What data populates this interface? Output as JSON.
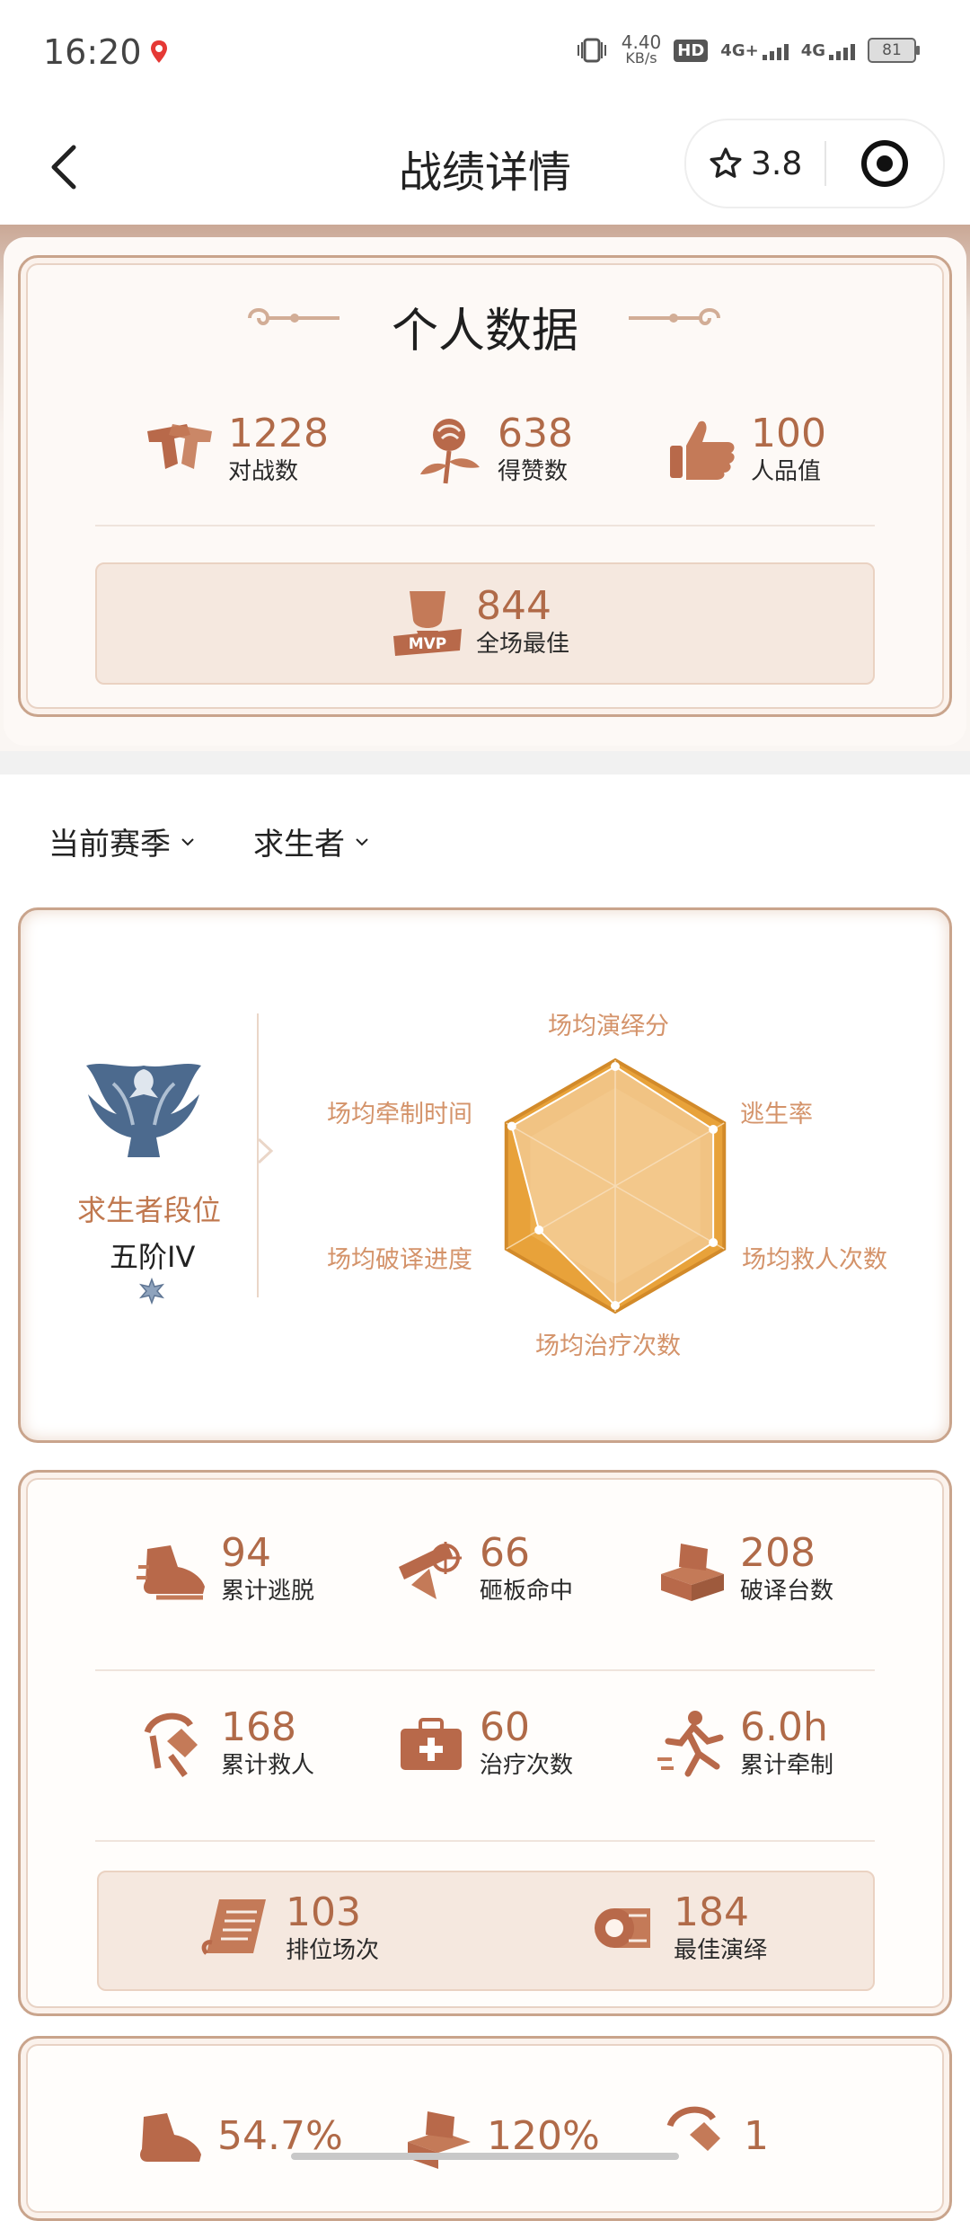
{
  "status_bar": {
    "time": "16:20",
    "speed_value": "4.40",
    "speed_unit": "KB/s",
    "hd_badge": "HD",
    "sim1": "1",
    "sim2": "2",
    "net1": "4G+",
    "net2": "4G",
    "battery": "81"
  },
  "header": {
    "title": "战绩详情",
    "rating": "3.8"
  },
  "personal": {
    "title": "个人数据",
    "stats": [
      {
        "value": "1228",
        "label": "对战数",
        "icon": "pistol-icon"
      },
      {
        "value": "638",
        "label": "得赞数",
        "icon": "rose-icon"
      },
      {
        "value": "100",
        "label": "人品值",
        "icon": "thumbs-up-icon"
      }
    ],
    "mvp": {
      "value": "844",
      "label": "全场最佳",
      "badge": "MVP",
      "icon": "mvp-trophy-icon"
    }
  },
  "filters": {
    "season": "当前赛季",
    "role": "求生者"
  },
  "rank": {
    "label": "求生者段位",
    "value": "五阶IV",
    "radar": {
      "axes": [
        "场均演绎分",
        "逃生率",
        "场均救人次数",
        "场均治疗次数",
        "场均破译进度",
        "场均牵制时间"
      ],
      "values": [
        0.95,
        0.9,
        0.9,
        0.95,
        0.7,
        0.95
      ]
    }
  },
  "details": {
    "row1": [
      {
        "value": "94",
        "label": "累计逃脱",
        "icon": "running-shoe-icon"
      },
      {
        "value": "66",
        "label": "砸板命中",
        "icon": "pallet-hit-icon"
      },
      {
        "value": "208",
        "label": "破译台数",
        "icon": "cipher-machine-icon"
      }
    ],
    "row2": [
      {
        "value": "168",
        "label": "累计救人",
        "icon": "rescue-hook-icon"
      },
      {
        "value": "60",
        "label": "治疗次数",
        "icon": "medkit-icon"
      },
      {
        "value": "6.0h",
        "label": "累计牵制",
        "icon": "running-man-icon"
      }
    ],
    "row3": [
      {
        "value": "103",
        "label": "排位场次",
        "icon": "scroll-icon"
      },
      {
        "value": "184",
        "label": "最佳演绎",
        "icon": "film-reel-icon"
      }
    ]
  },
  "rates": [
    {
      "value": "54.7%",
      "icon": "running-shoe-icon"
    },
    {
      "value": "120%",
      "icon": "cipher-machine-icon"
    },
    {
      "value": "1",
      "icon": "rescue-hook-icon"
    }
  ],
  "colors": {
    "accent": "#b06a48",
    "radar_fill": "#e8a23a",
    "label": "#d4936a",
    "frame": "#c9a48c"
  }
}
